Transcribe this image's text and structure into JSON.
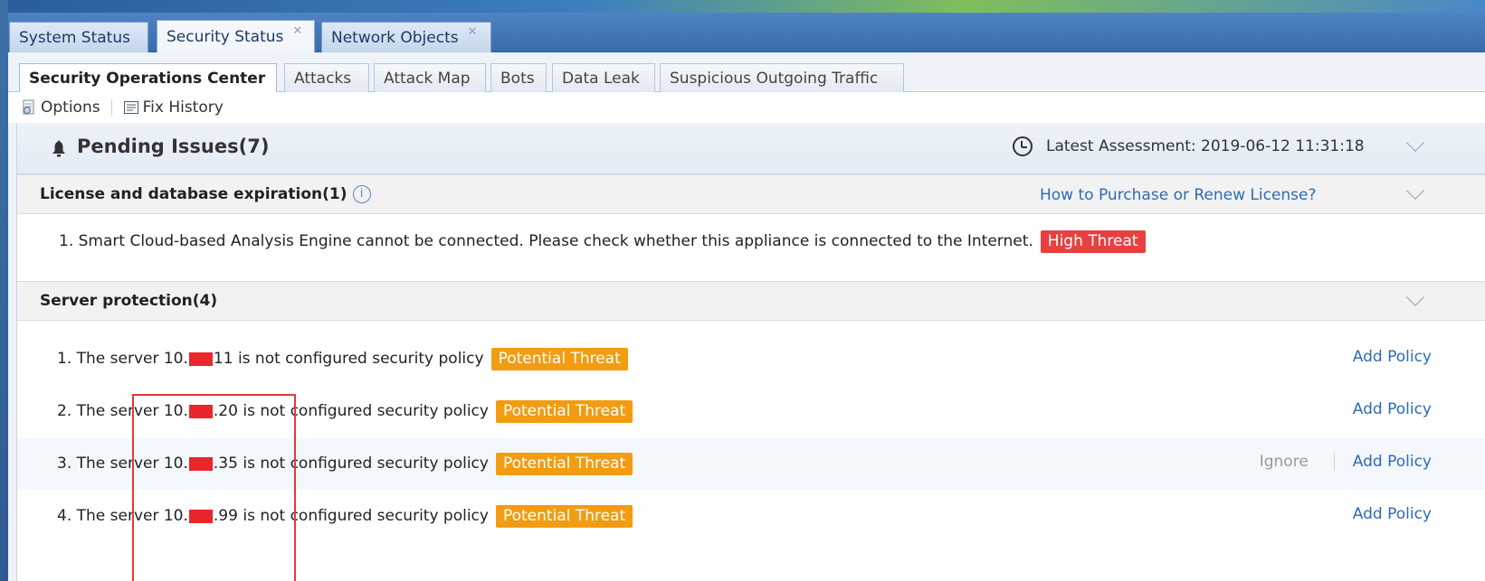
{
  "outer_tabs": [
    {
      "label": "System Status",
      "closable": false
    },
    {
      "label": "Security Status",
      "closable": true,
      "active": true
    },
    {
      "label": "Network Objects",
      "closable": true
    }
  ],
  "inner_tabs": [
    {
      "label": "Security Operations Center",
      "active": true
    },
    {
      "label": "Attacks"
    },
    {
      "label": "Attack Map"
    },
    {
      "label": "Bots"
    },
    {
      "label": "Data Leak"
    },
    {
      "label": "Suspicious Outgoing Traffic"
    }
  ],
  "toolbar": {
    "options_label": "Options",
    "fix_history_label": "Fix History"
  },
  "pending": {
    "title": "Pending Issues(7)",
    "latest_assessment_label": "Latest Assessment: 2019-06-12 11:31:18"
  },
  "license_section": {
    "title": "License and database expiration(1)",
    "info_glyph": "i",
    "link": "How to Purchase or Renew License?",
    "items": [
      {
        "text": "1. Smart Cloud-based Analysis Engine cannot be connected. Please check whether this appliance is connected to the Internet.",
        "badge": "High Threat"
      }
    ]
  },
  "server_section": {
    "title": "Server protection(4)",
    "items": [
      {
        "prefix": "1. The server 10.",
        "suffix": "11 is not configured security policy",
        "badge": "Potential Threat",
        "add": "Add Policy"
      },
      {
        "prefix": "2. The server 10.",
        "suffix": ".20 is not configured security policy",
        "badge": "Potential Threat",
        "add": "Add Policy"
      },
      {
        "prefix": "3. The server 10.",
        "suffix": ".35 is not configured security policy",
        "badge": "Potential Threat",
        "ignore": "Ignore",
        "add": "Add Policy"
      },
      {
        "prefix": "4. The server 10.",
        "suffix": ".99 is not configured security policy",
        "badge": "Potential Threat",
        "add": "Add Policy"
      }
    ]
  },
  "colors": {
    "high_threat": "#e84040",
    "potential_threat": "#f29c11",
    "link": "#2d6bb5",
    "annotation": "#e23a3a"
  },
  "icons": [
    "close-icon",
    "options-icon",
    "fix-history-icon",
    "bell-icon",
    "clock-icon",
    "info-icon",
    "chevron-down-icon"
  ]
}
